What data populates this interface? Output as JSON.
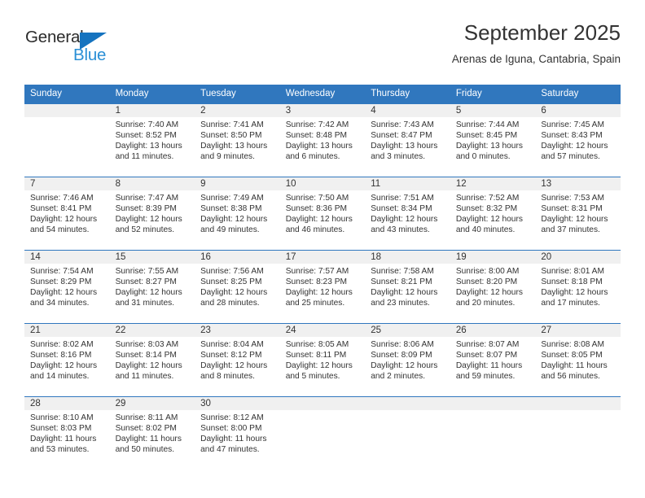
{
  "brand": {
    "name_top": "General",
    "name_bottom": "Blue",
    "color_top": "#2b2b2b",
    "color_bottom": "#2a8fd6",
    "triangle_color": "#1573bf"
  },
  "header": {
    "title": "September 2025",
    "subtitle": "Arenas de Iguna, Cantabria, Spain"
  },
  "theme": {
    "accent": "#3077be",
    "daynum_band": "#f0f0f0",
    "text": "#333333"
  },
  "calendar": {
    "weekday_headers": [
      "Sunday",
      "Monday",
      "Tuesday",
      "Wednesday",
      "Thursday",
      "Friday",
      "Saturday"
    ],
    "weeks": [
      [
        {
          "day": "",
          "sunrise": "",
          "sunset": "",
          "daylight": "",
          "daylight2": ""
        },
        {
          "day": "1",
          "sunrise": "Sunrise: 7:40 AM",
          "sunset": "Sunset: 8:52 PM",
          "daylight": "Daylight: 13 hours",
          "daylight2": "and 11 minutes."
        },
        {
          "day": "2",
          "sunrise": "Sunrise: 7:41 AM",
          "sunset": "Sunset: 8:50 PM",
          "daylight": "Daylight: 13 hours",
          "daylight2": "and 9 minutes."
        },
        {
          "day": "3",
          "sunrise": "Sunrise: 7:42 AM",
          "sunset": "Sunset: 8:48 PM",
          "daylight": "Daylight: 13 hours",
          "daylight2": "and 6 minutes."
        },
        {
          "day": "4",
          "sunrise": "Sunrise: 7:43 AM",
          "sunset": "Sunset: 8:47 PM",
          "daylight": "Daylight: 13 hours",
          "daylight2": "and 3 minutes."
        },
        {
          "day": "5",
          "sunrise": "Sunrise: 7:44 AM",
          "sunset": "Sunset: 8:45 PM",
          "daylight": "Daylight: 13 hours",
          "daylight2": "and 0 minutes."
        },
        {
          "day": "6",
          "sunrise": "Sunrise: 7:45 AM",
          "sunset": "Sunset: 8:43 PM",
          "daylight": "Daylight: 12 hours",
          "daylight2": "and 57 minutes."
        }
      ],
      [
        {
          "day": "7",
          "sunrise": "Sunrise: 7:46 AM",
          "sunset": "Sunset: 8:41 PM",
          "daylight": "Daylight: 12 hours",
          "daylight2": "and 54 minutes."
        },
        {
          "day": "8",
          "sunrise": "Sunrise: 7:47 AM",
          "sunset": "Sunset: 8:39 PM",
          "daylight": "Daylight: 12 hours",
          "daylight2": "and 52 minutes."
        },
        {
          "day": "9",
          "sunrise": "Sunrise: 7:49 AM",
          "sunset": "Sunset: 8:38 PM",
          "daylight": "Daylight: 12 hours",
          "daylight2": "and 49 minutes."
        },
        {
          "day": "10",
          "sunrise": "Sunrise: 7:50 AM",
          "sunset": "Sunset: 8:36 PM",
          "daylight": "Daylight: 12 hours",
          "daylight2": "and 46 minutes."
        },
        {
          "day": "11",
          "sunrise": "Sunrise: 7:51 AM",
          "sunset": "Sunset: 8:34 PM",
          "daylight": "Daylight: 12 hours",
          "daylight2": "and 43 minutes."
        },
        {
          "day": "12",
          "sunrise": "Sunrise: 7:52 AM",
          "sunset": "Sunset: 8:32 PM",
          "daylight": "Daylight: 12 hours",
          "daylight2": "and 40 minutes."
        },
        {
          "day": "13",
          "sunrise": "Sunrise: 7:53 AM",
          "sunset": "Sunset: 8:31 PM",
          "daylight": "Daylight: 12 hours",
          "daylight2": "and 37 minutes."
        }
      ],
      [
        {
          "day": "14",
          "sunrise": "Sunrise: 7:54 AM",
          "sunset": "Sunset: 8:29 PM",
          "daylight": "Daylight: 12 hours",
          "daylight2": "and 34 minutes."
        },
        {
          "day": "15",
          "sunrise": "Sunrise: 7:55 AM",
          "sunset": "Sunset: 8:27 PM",
          "daylight": "Daylight: 12 hours",
          "daylight2": "and 31 minutes."
        },
        {
          "day": "16",
          "sunrise": "Sunrise: 7:56 AM",
          "sunset": "Sunset: 8:25 PM",
          "daylight": "Daylight: 12 hours",
          "daylight2": "and 28 minutes."
        },
        {
          "day": "17",
          "sunrise": "Sunrise: 7:57 AM",
          "sunset": "Sunset: 8:23 PM",
          "daylight": "Daylight: 12 hours",
          "daylight2": "and 25 minutes."
        },
        {
          "day": "18",
          "sunrise": "Sunrise: 7:58 AM",
          "sunset": "Sunset: 8:21 PM",
          "daylight": "Daylight: 12 hours",
          "daylight2": "and 23 minutes."
        },
        {
          "day": "19",
          "sunrise": "Sunrise: 8:00 AM",
          "sunset": "Sunset: 8:20 PM",
          "daylight": "Daylight: 12 hours",
          "daylight2": "and 20 minutes."
        },
        {
          "day": "20",
          "sunrise": "Sunrise: 8:01 AM",
          "sunset": "Sunset: 8:18 PM",
          "daylight": "Daylight: 12 hours",
          "daylight2": "and 17 minutes."
        }
      ],
      [
        {
          "day": "21",
          "sunrise": "Sunrise: 8:02 AM",
          "sunset": "Sunset: 8:16 PM",
          "daylight": "Daylight: 12 hours",
          "daylight2": "and 14 minutes."
        },
        {
          "day": "22",
          "sunrise": "Sunrise: 8:03 AM",
          "sunset": "Sunset: 8:14 PM",
          "daylight": "Daylight: 12 hours",
          "daylight2": "and 11 minutes."
        },
        {
          "day": "23",
          "sunrise": "Sunrise: 8:04 AM",
          "sunset": "Sunset: 8:12 PM",
          "daylight": "Daylight: 12 hours",
          "daylight2": "and 8 minutes."
        },
        {
          "day": "24",
          "sunrise": "Sunrise: 8:05 AM",
          "sunset": "Sunset: 8:11 PM",
          "daylight": "Daylight: 12 hours",
          "daylight2": "and 5 minutes."
        },
        {
          "day": "25",
          "sunrise": "Sunrise: 8:06 AM",
          "sunset": "Sunset: 8:09 PM",
          "daylight": "Daylight: 12 hours",
          "daylight2": "and 2 minutes."
        },
        {
          "day": "26",
          "sunrise": "Sunrise: 8:07 AM",
          "sunset": "Sunset: 8:07 PM",
          "daylight": "Daylight: 11 hours",
          "daylight2": "and 59 minutes."
        },
        {
          "day": "27",
          "sunrise": "Sunrise: 8:08 AM",
          "sunset": "Sunset: 8:05 PM",
          "daylight": "Daylight: 11 hours",
          "daylight2": "and 56 minutes."
        }
      ],
      [
        {
          "day": "28",
          "sunrise": "Sunrise: 8:10 AM",
          "sunset": "Sunset: 8:03 PM",
          "daylight": "Daylight: 11 hours",
          "daylight2": "and 53 minutes."
        },
        {
          "day": "29",
          "sunrise": "Sunrise: 8:11 AM",
          "sunset": "Sunset: 8:02 PM",
          "daylight": "Daylight: 11 hours",
          "daylight2": "and 50 minutes."
        },
        {
          "day": "30",
          "sunrise": "Sunrise: 8:12 AM",
          "sunset": "Sunset: 8:00 PM",
          "daylight": "Daylight: 11 hours",
          "daylight2": "and 47 minutes."
        },
        {
          "day": "",
          "sunrise": "",
          "sunset": "",
          "daylight": "",
          "daylight2": ""
        },
        {
          "day": "",
          "sunrise": "",
          "sunset": "",
          "daylight": "",
          "daylight2": ""
        },
        {
          "day": "",
          "sunrise": "",
          "sunset": "",
          "daylight": "",
          "daylight2": ""
        },
        {
          "day": "",
          "sunrise": "",
          "sunset": "",
          "daylight": "",
          "daylight2": ""
        }
      ]
    ]
  }
}
